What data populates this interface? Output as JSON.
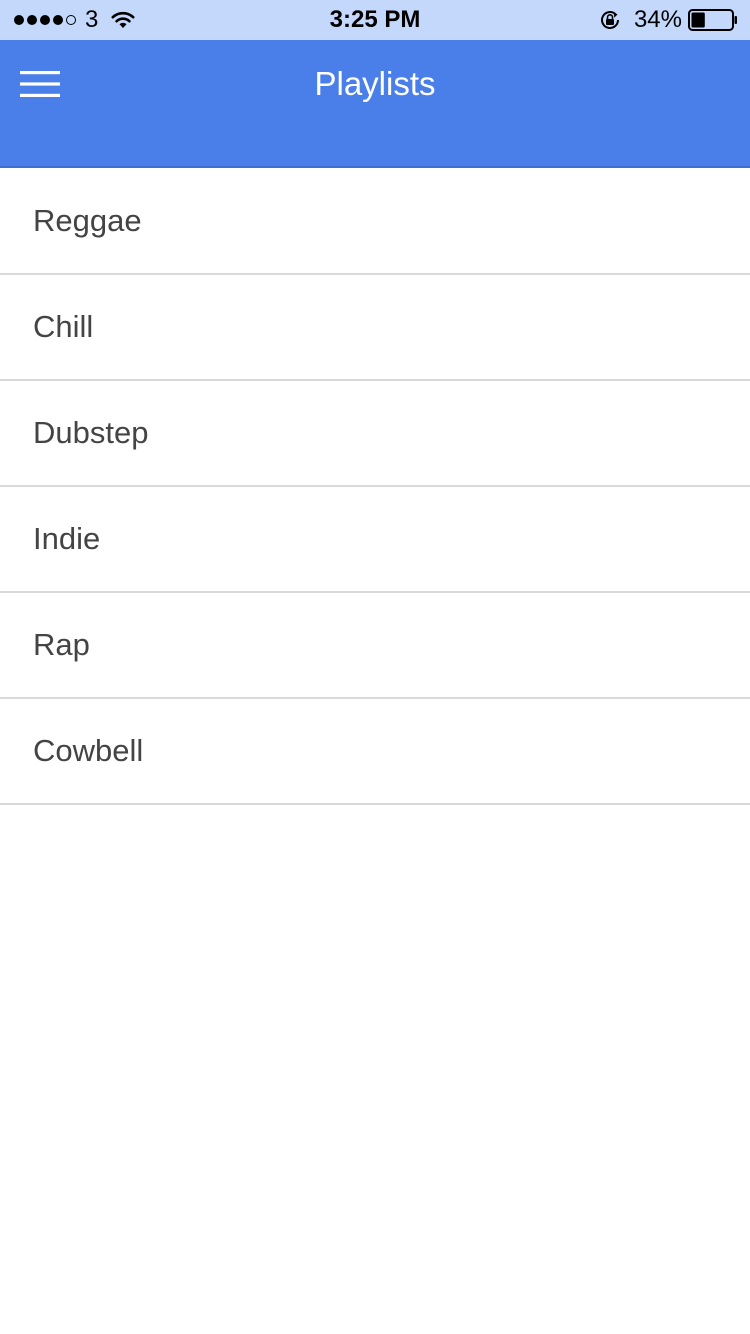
{
  "status_bar": {
    "signal_bars_filled": 4,
    "signal_bars_total": 5,
    "carrier": "3",
    "time": "3:25 PM",
    "battery_percent": "34%",
    "battery_level": 0.34,
    "icons": [
      "wifi-icon",
      "orientation-lock-icon",
      "battery-icon"
    ]
  },
  "header": {
    "title": "Playlists",
    "menu_icon": "hamburger-menu-icon",
    "background_color": "#4a7fe9"
  },
  "playlists": [
    {
      "label": "Reggae"
    },
    {
      "label": "Chill"
    },
    {
      "label": "Dubstep"
    },
    {
      "label": "Indie"
    },
    {
      "label": "Rap"
    },
    {
      "label": "Cowbell"
    }
  ]
}
